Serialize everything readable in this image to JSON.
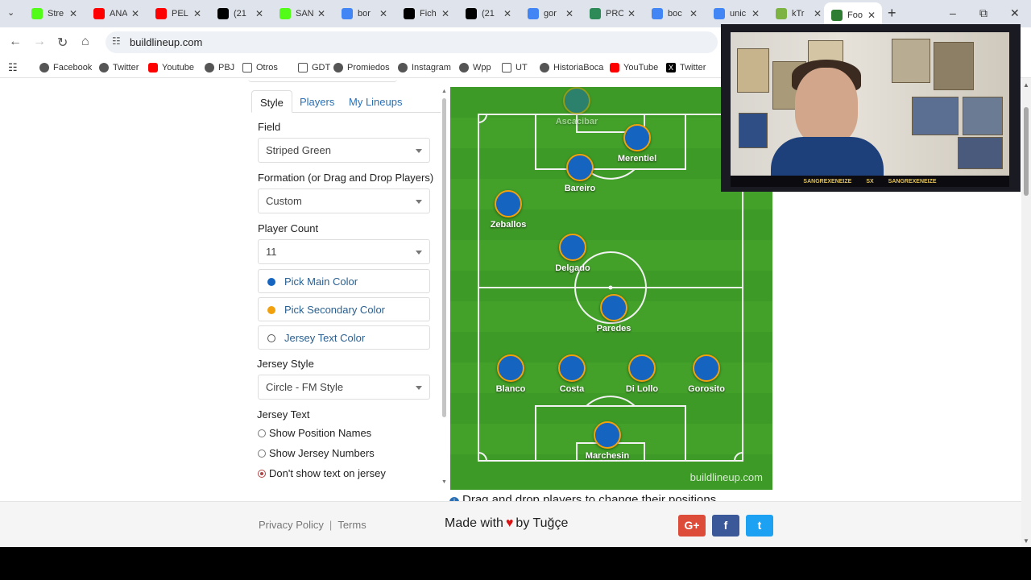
{
  "browser": {
    "tabs": [
      {
        "label": "Stre",
        "favicon": "kick-icon",
        "color": "#53fc18"
      },
      {
        "label": "ANA",
        "favicon": "youtube-icon",
        "color": "#ff0000"
      },
      {
        "label": "PEL",
        "favicon": "youtube-icon",
        "color": "#ff0000"
      },
      {
        "label": "(21",
        "favicon": "x-icon",
        "color": "#000000"
      },
      {
        "label": "SAN",
        "favicon": "kick-icon",
        "color": "#53fc18"
      },
      {
        "label": "bor",
        "favicon": "google-icon",
        "color": "#4285f4"
      },
      {
        "label": "Fich",
        "favicon": "x-icon",
        "color": "#000000"
      },
      {
        "label": "(21",
        "favicon": "x-icon",
        "color": "#000000"
      },
      {
        "label": "gor",
        "favicon": "google-icon",
        "color": "#4285f4"
      },
      {
        "label": "PRO",
        "favicon": "soccer-icon",
        "color": "#2e8b57"
      },
      {
        "label": "boc",
        "favicon": "google-icon",
        "color": "#4285f4"
      },
      {
        "label": "unic",
        "favicon": "google-icon",
        "color": "#4285f4"
      },
      {
        "label": "kTr",
        "favicon": "sheet-icon",
        "color": "#7cb342"
      },
      {
        "label": "Foo",
        "favicon": "football-icon",
        "color": "#2e7d32",
        "active": true
      }
    ],
    "url": "buildlineup.com",
    "bookmarks": [
      {
        "label": "Facebook",
        "icon": "globe-icon"
      },
      {
        "label": "Twitter",
        "icon": "globe-icon"
      },
      {
        "label": "Youtube",
        "icon": "youtube-icon"
      },
      {
        "label": "PBJ",
        "icon": "globe-icon"
      },
      {
        "label": "Otros",
        "icon": "folder-icon"
      },
      {
        "label": "GDT",
        "icon": "folder-icon"
      },
      {
        "label": "Promiedos",
        "icon": "globe-icon"
      },
      {
        "label": "Instagram",
        "icon": "globe-icon"
      },
      {
        "label": "Wpp",
        "icon": "globe-icon"
      },
      {
        "label": "UT",
        "icon": "folder-icon"
      },
      {
        "label": "HistoriaBoca",
        "icon": "globe-icon"
      },
      {
        "label": "YouTube",
        "icon": "youtube-icon"
      },
      {
        "label": "Twitter",
        "icon": "x-icon"
      }
    ]
  },
  "panel": {
    "tabs": [
      "Style",
      "Players",
      "My Lineups"
    ],
    "field_label": "Field",
    "field_value": "Striped Green",
    "formation_label": "Formation (or Drag and Drop Players)",
    "formation_value": "Custom",
    "player_count_label": "Player Count",
    "player_count_value": "11",
    "main_color_button": "Pick Main Color",
    "secondary_color_button": "Pick Secondary Color",
    "text_color_button": "Jersey Text Color",
    "main_color": "#1565c0",
    "secondary_color": "#f0a10d",
    "text_color": "#ffffff",
    "jersey_style_label": "Jersey Style",
    "jersey_style_value": "Circle - FM Style",
    "jersey_text_label": "Jersey Text",
    "jersey_text_options": [
      {
        "label": "Show Position Names",
        "checked": false
      },
      {
        "label": "Show Jersey Numbers",
        "checked": false
      },
      {
        "label": "Don't show text on jersey",
        "checked": true
      }
    ]
  },
  "field": {
    "players": [
      {
        "name": "Ascacibar",
        "dragging": true
      },
      {
        "name": "Merentiel"
      },
      {
        "name": "Bareiro"
      },
      {
        "name": "Zeballos"
      },
      {
        "name": "Delgado"
      },
      {
        "name": "Paredes"
      },
      {
        "name": "Blanco"
      },
      {
        "name": "Costa"
      },
      {
        "name": "Di Lollo"
      },
      {
        "name": "Gorosito"
      },
      {
        "name": "Marchesin"
      }
    ],
    "watermark": "buildlineup.com",
    "hint": "Drag and drop players to change their positions"
  },
  "footer": {
    "privacy": "Privacy Policy",
    "separator": "|",
    "terms": "Terms",
    "made_with_prefix": "Made with",
    "made_with_suffix": "by Tuğçe",
    "social": [
      {
        "label": "G+",
        "color": "#dd4b39"
      },
      {
        "label": "f",
        "color": "#3b5998"
      },
      {
        "label": "t",
        "color": "#1da1f2"
      }
    ]
  },
  "webcam": {
    "banner": [
      "SANGREXENEIZE",
      "SX",
      "SANGREXENEIZE"
    ]
  }
}
